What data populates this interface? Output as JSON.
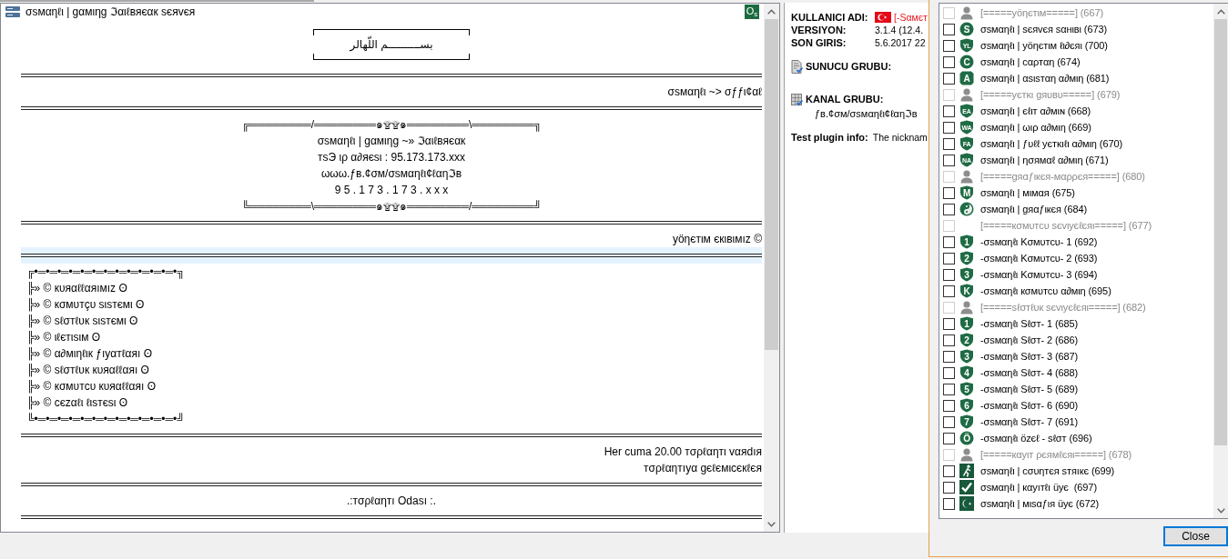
{
  "chat": {
    "title": "σsмαηℓι | gαмιηg ℑαιℓвяєαк sєяvєя",
    "badge": "O$_{s}$",
    "lines": [
      {
        "kind": "framed",
        "text": "بســــــــــم اللّهالر",
        "highlighted": false
      },
      {
        "kind": "rule",
        "highlighted": false
      },
      {
        "kind": "right",
        "text": "σsмαηℓι ~> σƒƒι¢αℓ",
        "highlighted": false
      },
      {
        "kind": "rule",
        "highlighted": false
      },
      {
        "kind": "center",
        "text": "╔════════/════════๑۩۩๑════════\\════════╗",
        "highlighted": false
      },
      {
        "kind": "center",
        "text": "σsмαηℓι | gαмιηg ~» ℑαιℓвяєαк",
        "highlighted": false
      },
      {
        "kind": "center",
        "text": "тsЭ ιρ α∂яєsι : 95.173.173.xxx",
        "highlighted": false
      },
      {
        "kind": "center",
        "text": "ωωω.ƒв.¢σм/σsмαηℓι¢ℓαηℑв",
        "highlighted": false
      },
      {
        "kind": "center",
        "text": "9 5 . 1 7 3 . 1 7 3 . x x x",
        "highlighted": false
      },
      {
        "kind": "center",
        "text": "╚════════\\════════๑۩۩๑════════/════════╝",
        "highlighted": false
      },
      {
        "kind": "rule",
        "highlighted": false
      },
      {
        "kind": "right",
        "text": "yöηєтιм єкιвιмız ©",
        "highlighted": false
      },
      {
        "kind": "rule",
        "highlighted": true
      },
      {
        "kind": "left",
        "text": "╔•═•═•═•═•═•═•═•═•═•═•═•═•╗",
        "highlighted": false
      },
      {
        "kind": "left",
        "text": "╠» © кυяαℓℓαяıмız ʘ",
        "highlighted": false
      },
      {
        "kind": "left",
        "text": "╠» © кσмυтçυ sιsтємι ʘ",
        "highlighted": false
      },
      {
        "kind": "left",
        "text": "╠» © sℓσтℓυк sιsтємι ʘ",
        "highlighted": false
      },
      {
        "kind": "left",
        "text": "╠» © ιℓєтιsιм ʘ",
        "highlighted": false
      },
      {
        "kind": "left",
        "text": "╠» © α∂мιηℓιк ƒıyαтℓαяı ʘ",
        "highlighted": false
      },
      {
        "kind": "left",
        "text": "╠» © sℓσтℓυк кυяαℓℓαяı ʘ",
        "highlighted": false
      },
      {
        "kind": "left",
        "text": "╠» © кσмυтcυ кυяαℓℓαяı ʘ",
        "highlighted": false
      },
      {
        "kind": "left",
        "text": "╠» © cєzαℓι ℓιsтєsι ʘ",
        "highlighted": false
      },
      {
        "kind": "left",
        "text": "╚•═•═•═•═•═•═•═•═•═•═•═•═•╝",
        "highlighted": false
      },
      {
        "kind": "rule",
        "highlighted": false
      },
      {
        "kind": "right",
        "text": "Her cuma 20.00 тσρℓαηтι vαяdıя",
        "highlighted": false
      },
      {
        "kind": "right",
        "text": "тσρℓαηтıyα gєℓємιcєкℓєя",
        "highlighted": false
      },
      {
        "kind": "rule",
        "highlighted": false
      },
      {
        "kind": "center",
        "text": ".:тσρℓαηтı Odası :.",
        "highlighted": false
      },
      {
        "kind": "rule",
        "highlighted": false
      }
    ]
  },
  "info": {
    "fields": [
      {
        "kind": "nickname",
        "label": "KULLANICI ADI:",
        "value": "[-Sαмєт"
      },
      {
        "kind": "plain",
        "label": "VERSIYON:",
        "value": "3.1.4 (12.4."
      },
      {
        "kind": "plain",
        "label": "SON GIRIS:",
        "value": "5.6.2017 22"
      }
    ],
    "groups": [
      {
        "kind": "server",
        "label": "SUNUCU GRUBU:"
      },
      {
        "kind": "channel",
        "label": "KANAL GRUBU:",
        "value": "ƒв.¢σм/σsмαηℓι¢ℓαηℑв"
      }
    ],
    "plugin": {
      "label": "Test plugin info:",
      "value": "The nicknam"
    }
  },
  "dialog": {
    "groups": [
      {
        "kind": "person",
        "disabled": true,
        "checked": false,
        "text": "[=====yöηєтιм=====] (667)"
      },
      {
        "kind": "disc",
        "badge": "S",
        "disabled": false,
        "checked": false,
        "text": "σsмαηℓι | sєяvєя sαнιвι (673)"
      },
      {
        "kind": "shield",
        "badge": "YL",
        "disabled": false,
        "checked": false,
        "text": "σsмαηℓι | yöηєтιм ℓι∂єяι (700)"
      },
      {
        "kind": "disc",
        "badge": "C",
        "disabled": false,
        "checked": false,
        "text": "σsмαηℓι | cαρтαη (674)"
      },
      {
        "kind": "tile",
        "badge": "A",
        "disabled": false,
        "checked": false,
        "text": "σsмαηℓι | αsιsтαη α∂мιη (681)"
      },
      {
        "kind": "person",
        "disabled": true,
        "checked": false,
        "text": "[=====yєтκι gяυвυ=====] (679)"
      },
      {
        "kind": "shield",
        "badge": "EA",
        "disabled": false,
        "checked": false,
        "text": "σsмαηℓι | єℓιт α∂мιɴ (668)"
      },
      {
        "kind": "shield",
        "badge": "WA",
        "disabled": false,
        "checked": false,
        "text": "σsмαηℓι | ωιρ α∂мιη (669)"
      },
      {
        "kind": "shield",
        "badge": "FA",
        "disabled": false,
        "checked": false,
        "text": "σsмαηℓι | ƒυℓℓ yєтκιℓι α∂мιη (670)"
      },
      {
        "kind": "shield",
        "badge": "NA",
        "disabled": false,
        "checked": false,
        "text": "σsмαηℓι | ησямαℓ α∂мιη (671)"
      },
      {
        "kind": "person",
        "disabled": true,
        "checked": false,
        "text": "[=====gяαƒιкєя-мαρρєя=====] (680)"
      },
      {
        "kind": "shield",
        "badge": "M",
        "disabled": false,
        "checked": false,
        "text": "σsмαηℓι | мιмαя (675)"
      },
      {
        "kind": "swirl",
        "disabled": false,
        "checked": false,
        "text": "σsмαηℓι | gяαƒιкєя (684)"
      },
      {
        "kind": "plain",
        "disabled": true,
        "checked": false,
        "text": "[=====кσмυтcυ sєvιyєℓєяι=====] (677)"
      },
      {
        "kind": "shield",
        "badge": "1",
        "disabled": false,
        "checked": false,
        "text": "-σsмαηℓι Kσмυтcυ- 1 (692)"
      },
      {
        "kind": "shield",
        "badge": "2",
        "disabled": false,
        "checked": false,
        "text": "-σsмαηℓι Kσмυтcυ- 2 (693)"
      },
      {
        "kind": "shield",
        "badge": "3",
        "disabled": false,
        "checked": false,
        "text": "-σsмαηℓι Kσмυтcυ- 3 (694)"
      },
      {
        "kind": "shield",
        "badge": "K",
        "disabled": false,
        "checked": false,
        "text": "-σsмαηℓι кσмυтcυ α∂мιη (695)"
      },
      {
        "kind": "person",
        "disabled": true,
        "checked": false,
        "text": "[=====sℓσтℓυк sєvιyєℓєяι=====] (682)"
      },
      {
        "kind": "shield",
        "badge": "1",
        "disabled": false,
        "checked": false,
        "text": "-σsмαηℓι Sℓσт- 1 (685)"
      },
      {
        "kind": "shield",
        "badge": "2",
        "disabled": false,
        "checked": false,
        "text": "-σsмαηℓι Sℓσт- 2 (686)"
      },
      {
        "kind": "shield",
        "badge": "3",
        "disabled": false,
        "checked": false,
        "text": "-σsмαηℓι Sℓσт- 3 (687)"
      },
      {
        "kind": "shield",
        "badge": "4",
        "disabled": false,
        "checked": false,
        "text": "-σsмαηℓι Sℓσт- 4 (688)"
      },
      {
        "kind": "shield",
        "badge": "5",
        "disabled": false,
        "checked": false,
        "text": "-σsмαηℓι Sℓσт- 5 (689)"
      },
      {
        "kind": "shield",
        "badge": "6",
        "disabled": false,
        "checked": false,
        "text": "-σsмαηℓι Sℓσт- 6 (690)"
      },
      {
        "kind": "shield",
        "badge": "7",
        "disabled": false,
        "checked": false,
        "text": "-σsмαηℓι Sℓσт- 7 (691)"
      },
      {
        "kind": "disc",
        "badge": "Ö",
        "disabled": false,
        "checked": false,
        "text": "-σsмαηℓι özєℓ - sℓσт (696)"
      },
      {
        "kind": "person",
        "disabled": true,
        "checked": false,
        "text": "[=====кαyιт ρєямℓєяι=====] (678)"
      },
      {
        "kind": "runner",
        "disabled": false,
        "checked": false,
        "text": "σsмαηℓι | cσυηтєя sтяıкє (699)"
      },
      {
        "kind": "tick",
        "disabled": false,
        "checked": false,
        "text": "σsмαηℓι | кαyıтℓı üyє  (697)"
      },
      {
        "kind": "crescent",
        "disabled": false,
        "checked": false,
        "text": "σsмαηℓι | мιsαƒιя üyє (672)"
      }
    ],
    "buttons": [
      {
        "label": "Close",
        "focused": true
      }
    ]
  }
}
